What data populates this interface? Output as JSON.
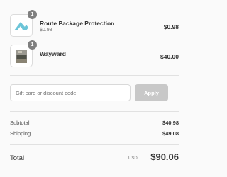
{
  "items": [
    {
      "quantity": "1",
      "title": "Route Package Protection",
      "subtitle": "$0.98",
      "price": "$0.98",
      "thumbnail_icon": "route-logo-icon"
    },
    {
      "quantity": "1",
      "title": "Wayward",
      "price": "$40.00",
      "thumbnail_icon": "product-photo-icon"
    }
  ],
  "discount": {
    "placeholder": "Gift card or discount code",
    "value": "",
    "apply_label": "Apply"
  },
  "subtotal": {
    "label": "Subtotal",
    "value": "$40.98"
  },
  "shipping": {
    "label": "Shipping",
    "value": "$49.08"
  },
  "total": {
    "label": "Total",
    "currency": "USD",
    "value": "$90.06"
  },
  "colors": {
    "background": "#fafafa",
    "text": "#333333",
    "muted_text": "#737373",
    "badge": "#7f7f7f",
    "apply_button": "#c8c8c8",
    "route_logo": "#6cc5d8",
    "divider": "#e1e1e1"
  }
}
